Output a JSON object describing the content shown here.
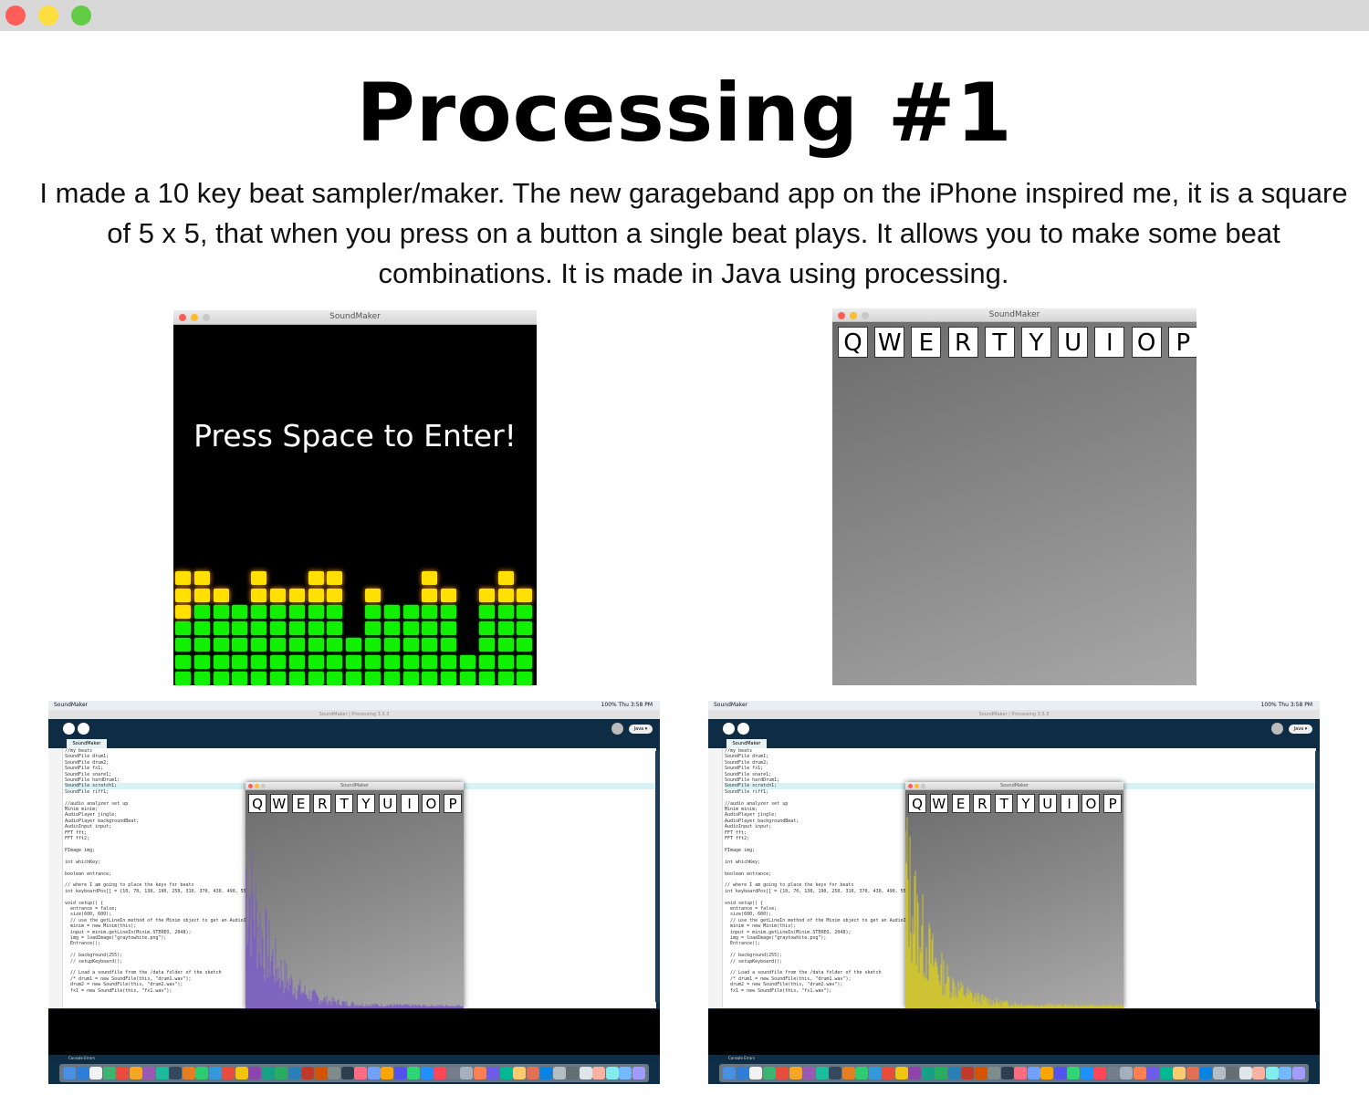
{
  "window": {
    "buttons": [
      "close",
      "minimize",
      "zoom"
    ]
  },
  "title": "Processing #1",
  "description": "I made a 10 key beat sampler/maker. The new garageband app on the iPhone inspired me, it is a square of 5 x 5, that when you press on a button a single beat plays. It allows you to make some beat combinations. It is made in Java using processing.",
  "shot1": {
    "window_title": "SoundMaker",
    "message": "Press Space to Enter!",
    "equalizer_green_levels": [
      4,
      5,
      5,
      5,
      5,
      5,
      5,
      5,
      5,
      3,
      5,
      5,
      5,
      5,
      5,
      2,
      5,
      5,
      5
    ],
    "equalizer_yellow_levels": [
      3,
      2,
      1,
      0,
      2,
      1,
      1,
      2,
      2,
      0,
      1,
      0,
      0,
      2,
      1,
      0,
      1,
      2,
      1
    ],
    "colors": {
      "background": "#000000",
      "green": "#10f000",
      "yellow": "#ffe000"
    }
  },
  "shot2": {
    "window_title": "SoundMaker",
    "keys": [
      "Q",
      "W",
      "E",
      "R",
      "T",
      "Y",
      "U",
      "I",
      "O",
      "P"
    ]
  },
  "ide": {
    "app_name": "SoundMaker",
    "window_title": "SoundMaker | Processing 3.5.3",
    "clock": "Thu 3:58 PM",
    "battery": "100%",
    "mode": "Java ▾",
    "tab": "SoundMaker",
    "console_tabs": [
      "Console",
      "Errors"
    ],
    "code_lines": [
      "//my beats",
      "SoundFile drum1;",
      "SoundFile drum2;",
      "SoundFile fx1;",
      "SoundFile snare1;",
      "SoundFile hardDrum1;",
      "SoundFile scratch1;",
      "SoundFile riff1;",
      "",
      "//audio analyzer set up",
      "Minim minim;",
      "AudioPlayer jingle;",
      "AudioPlayer backgroundBeat;",
      "AudioInput input;",
      "FFT fft;",
      "FFT fft2;",
      "",
      "PImage img;",
      "",
      "int whichKey;",
      "",
      "boolean entrance;",
      "",
      "// where I am going to place the keys for beats",
      "int keyboardPos[] = {10, 70, 130, 190, 250, 310, 370, 430, 490, 550};",
      "",
      "void setup() {",
      "  entrance = false;",
      "  size(600, 600);",
      "  // use the getLineIn method of the Minim object to get an AudioInput",
      "  minim = new Minim(this);",
      "  input = minim.getLineIn(Minim.STEREO, 2048);",
      "  img = loadImage(\"graytowhite.png\");",
      "  Entrance();",
      "",
      "  // background(255);",
      "  // setupKeyboard();",
      "",
      "  // Load a soundfile from the /data folder of the sketch",
      "  /* drum1 = new SoundFile(this, \"drum1.wav\");",
      "  drum2 = new SoundFile(this, \"drum2.wav\");",
      "  fx1 = new SoundFile(this, \"fx1.wav\");"
    ],
    "sketch_window_title": "SoundMaker",
    "spectrum_colors": {
      "left": "#7b5cc7",
      "right": "#d8cc22"
    }
  },
  "dock_icon_colors": [
    "#4a90e2",
    "#2e7dd6",
    "#f2f2f2",
    "#3cb371",
    "#e94b3c",
    "#f5a623",
    "#9b59b6",
    "#1abc9c",
    "#34495e",
    "#e67e22",
    "#2ecc71",
    "#3498db",
    "#e74c3c",
    "#f1c40f",
    "#8e44ad",
    "#16a085",
    "#27ae60",
    "#2980b9",
    "#c0392b",
    "#d35400",
    "#7f8c8d",
    "#2c3e50",
    "#ff6b81",
    "#70a1ff",
    "#ffa502",
    "#5352ed",
    "#2ed573",
    "#1e90ff",
    "#ff4757",
    "#747d8c",
    "#a4b0be",
    "#ff7f50",
    "#6c5ce7",
    "#00b894",
    "#fdcb6e",
    "#e17055",
    "#0984e3",
    "#b2bec3",
    "#636e72",
    "#dfe6e9",
    "#fab1a0",
    "#81ecec",
    "#74b9ff",
    "#a29bfe"
  ]
}
